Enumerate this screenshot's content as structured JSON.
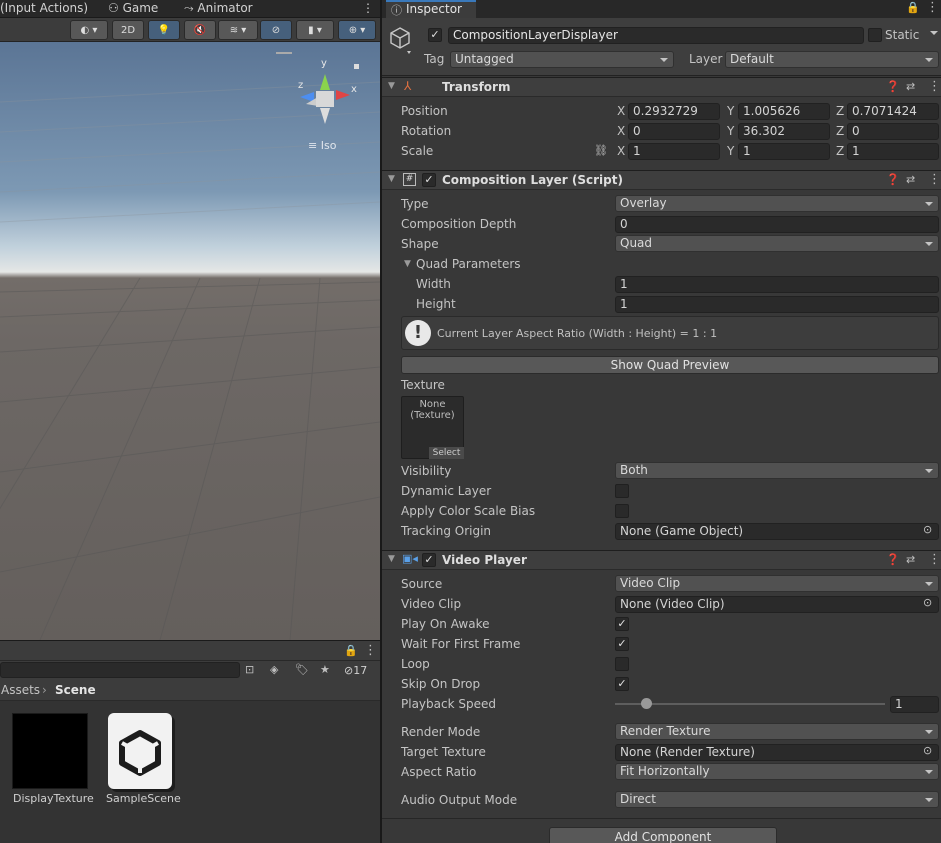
{
  "left_tabs": [
    "(Input Actions)",
    "Game",
    "Animator"
  ],
  "scene_toolbar": {
    "mode_2d": "2D"
  },
  "gizmo": {
    "y": "y",
    "x": "x",
    "z": "z",
    "projection": "Iso"
  },
  "project": {
    "hidden_count": "17",
    "breadcrumb_root": "Assets",
    "breadcrumb_current": "Scene",
    "assets": [
      {
        "name": "DisplayTexture"
      },
      {
        "name": "SampleScene"
      }
    ]
  },
  "inspector": {
    "tab": "Inspector",
    "object": {
      "name": "CompositionLayerDisplayer",
      "static_label": "Static",
      "tag_label": "Tag",
      "tag_value": "Untagged",
      "layer_label": "Layer",
      "layer_value": "Default"
    },
    "transform": {
      "title": "Transform",
      "rows": [
        {
          "label": "Position",
          "x": "0.2932729",
          "y": "1.005626",
          "z": "0.7071424"
        },
        {
          "label": "Rotation",
          "x": "0",
          "y": "36.302",
          "z": "0"
        },
        {
          "label": "Scale",
          "x": "1",
          "y": "1",
          "z": "1"
        }
      ]
    },
    "composition": {
      "title": "Composition Layer (Script)",
      "type_label": "Type",
      "type_value": "Overlay",
      "depth_label": "Composition Depth",
      "depth_value": "0",
      "shape_label": "Shape",
      "shape_value": "Quad",
      "quad_params_label": "Quad Parameters",
      "width_label": "Width",
      "width_value": "1",
      "height_label": "Height",
      "height_value": "1",
      "info_text": "Current Layer Aspect Ratio (Width : Height) = 1 : 1",
      "preview_button": "Show Quad Preview",
      "texture_label": "Texture",
      "texture_none": "None",
      "texture_type": "(Texture)",
      "texture_select": "Select",
      "visibility_label": "Visibility",
      "visibility_value": "Both",
      "dynamic_label": "Dynamic Layer",
      "color_bias_label": "Apply Color Scale Bias",
      "tracking_label": "Tracking Origin",
      "tracking_value": "None (Game Object)"
    },
    "video": {
      "title": "Video Player",
      "source_label": "Source",
      "source_value": "Video Clip",
      "clip_label": "Video Clip",
      "clip_value": "None (Video Clip)",
      "play_on_awake_label": "Play On Awake",
      "play_on_awake": true,
      "wait_first_label": "Wait For First Frame",
      "wait_first": true,
      "loop_label": "Loop",
      "loop": false,
      "skip_drop_label": "Skip On Drop",
      "skip_drop": true,
      "speed_label": "Playback Speed",
      "speed_value": "1",
      "render_mode_label": "Render Mode",
      "render_mode_value": "Render Texture",
      "target_texture_label": "Target Texture",
      "target_texture_value": "None (Render Texture)",
      "aspect_label": "Aspect Ratio",
      "aspect_value": "Fit Horizontally",
      "audio_label": "Audio Output Mode",
      "audio_value": "Direct"
    },
    "add_component": "Add Component"
  }
}
